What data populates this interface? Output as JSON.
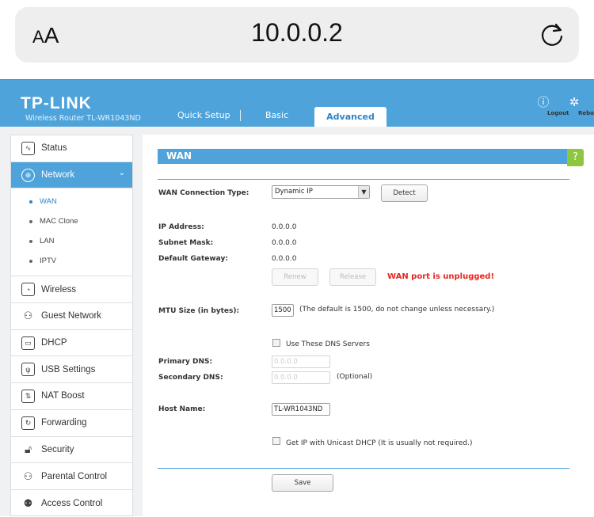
{
  "browser": {
    "aa_small": "A",
    "aa_big": "A",
    "url": "10.0.0.2"
  },
  "header": {
    "brand": "TP-LINK",
    "model": "Wireless Router TL-WR1043ND",
    "tabs": [
      "Quick Setup",
      "Basic",
      "Advanced"
    ],
    "active_tab": "Advanced",
    "logout_label": "Logout",
    "reboot_label": "Reboot",
    "accent_color": "#4ea3db"
  },
  "sidebar": {
    "items": [
      {
        "label": "Status",
        "icon": "pulse-icon"
      },
      {
        "label": "Network",
        "icon": "globe-icon",
        "active": true
      },
      {
        "label": "Wireless",
        "icon": "wifi-icon"
      },
      {
        "label": "Guest Network",
        "icon": "users-icon"
      },
      {
        "label": "DHCP",
        "icon": "monitor-icon"
      },
      {
        "label": "USB Settings",
        "icon": "usb-icon"
      },
      {
        "label": "NAT Boost",
        "icon": "arrows-icon"
      },
      {
        "label": "Forwarding",
        "icon": "forward-icon"
      },
      {
        "label": "Security",
        "icon": "lock-icon"
      },
      {
        "label": "Parental Control",
        "icon": "family-icon"
      },
      {
        "label": "Access Control",
        "icon": "user-shield-icon"
      }
    ],
    "network_sub": [
      "WAN",
      "MAC Clone",
      "LAN",
      "IPTV"
    ],
    "active_sub": "WAN"
  },
  "wan": {
    "title": "WAN",
    "help": "?",
    "conn_type_label": "WAN Connection Type:",
    "conn_type_value": "Dynamic IP",
    "detect_button": "Detect",
    "ip_label": "IP Address:",
    "ip_value": "0.0.0.0",
    "mask_label": "Subnet Mask:",
    "mask_value": "0.0.0.0",
    "gateway_label": "Default Gateway:",
    "gateway_value": "0.0.0.0",
    "renew_button": "Renew",
    "release_button": "Release",
    "warning": "WAN port is unplugged!",
    "mtu_label": "MTU Size (in bytes):",
    "mtu_value": "1500",
    "mtu_note": "(The default is 1500, do not change unless necessary.)",
    "dns_checkbox_label": "Use These DNS Servers",
    "primary_dns_label": "Primary DNS:",
    "primary_dns_value": "0.0.0.0",
    "secondary_dns_label": "Secondary DNS:",
    "secondary_dns_value": "0.0.0.0",
    "secondary_dns_note": "(Optional)",
    "host_label": "Host Name:",
    "host_value": "TL-WR1043ND",
    "unicast_label": "Get IP with Unicast DHCP (It is usually not required.)",
    "save_button": "Save",
    "warning_color": "#e5261f"
  }
}
